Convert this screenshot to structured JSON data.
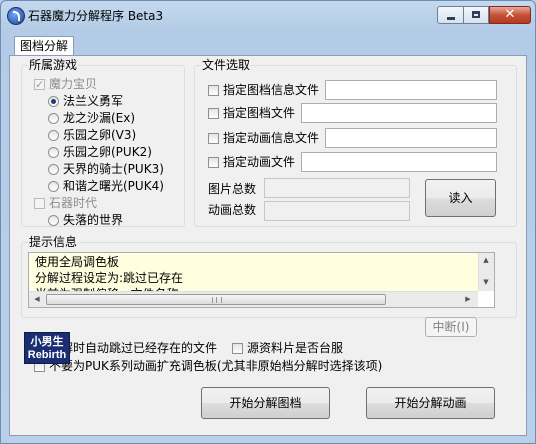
{
  "window": {
    "title": "石器魔力分解程序 Beta3"
  },
  "tab": {
    "label": "图档分解"
  },
  "games_group": {
    "label": "所属游戏",
    "categories": [
      {
        "label": "魔力宝贝",
        "checked": true,
        "enabled": false
      },
      {
        "label": "石器时代",
        "checked": false,
        "enabled": false
      }
    ],
    "crossgate_options": [
      "法兰义勇军",
      "龙之沙漏(Ex)",
      "乐园之卵(V3)",
      "乐园之卵(PUK2)",
      "天界的骑士(PUK3)",
      "和谐之曙光(PUK4)"
    ],
    "stoneage_options": [
      "失落的世界"
    ],
    "selected": "法兰义勇军"
  },
  "files_group": {
    "label": "文件选取",
    "rows": [
      {
        "label": "指定图档信息文件",
        "value": ""
      },
      {
        "label": "指定图档文件",
        "value": ""
      },
      {
        "label": "指定动画信息文件",
        "value": ""
      },
      {
        "label": "指定动画文件",
        "value": ""
      }
    ],
    "image_total_label": "图片总数",
    "image_total_value": "",
    "anim_total_label": "动画总数",
    "anim_total_value": "",
    "read_button": "读入"
  },
  "info_group": {
    "label": "提示信息",
    "lines": [
      "使用全局调色板",
      "分解过程设定为:跳过已存在",
      "当前为强制偏移...文件名称"
    ]
  },
  "interrupt_button": "中断(I)",
  "options": {
    "skip_existing": {
      "label": "分解时自动跳过已经存在的文件",
      "checked": true
    },
    "taiwan_server": {
      "label": "源资料片是否台服",
      "checked": false
    },
    "no_expand_palette": {
      "label": "不要为PUK系列动画扩充调色板(尤其非原始档分解时选择该项)",
      "checked": false
    }
  },
  "logo": {
    "line1": "小男生",
    "line2": "Rebirth"
  },
  "actions": {
    "start_images": "开始分解图档",
    "start_animations": "开始分解动画"
  }
}
